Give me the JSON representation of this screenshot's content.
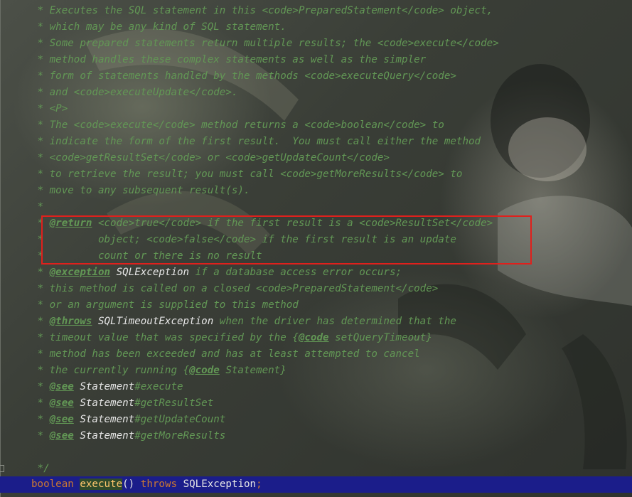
{
  "doc_lines": [
    [
      {
        "t": " * Executes the SQL statement in this <code>PreparedStatement</code> object,"
      }
    ],
    [
      {
        "t": " * which may be any kind of SQL statement."
      }
    ],
    [
      {
        "t": " * Some prepared statements return multiple results; the <code>execute</code>"
      }
    ],
    [
      {
        "t": " * method handles these complex statements as well as the simpler"
      }
    ],
    [
      {
        "t": " * form of statements handled by the methods <code>executeQuery</code>"
      }
    ],
    [
      {
        "t": " * and <code>executeUpdate</code>."
      }
    ],
    [
      {
        "t": " * <P>"
      }
    ],
    [
      {
        "t": " * The <code>execute</code> method returns a <code>boolean</code> to"
      }
    ],
    [
      {
        "t": " * indicate the form of the first result.  You must call either the method"
      }
    ],
    [
      {
        "t": " * <code>getResultSet</code> or <code>getUpdateCount</code>"
      }
    ],
    [
      {
        "t": " * to retrieve the result; you must call <code>getMoreResults</code> to"
      }
    ],
    [
      {
        "t": " * move to any subsequent result(s)."
      }
    ],
    [
      {
        "t": " *"
      }
    ],
    [
      {
        "t": " * "
      },
      {
        "t": "@return",
        "k": "tag"
      },
      {
        "t": " <code>true</code> if the first result is a <code>ResultSet</code>"
      }
    ],
    [
      {
        "t": " *         object; <code>false</code> if the first result is an update"
      }
    ],
    [
      {
        "t": " *         count or there is no result"
      }
    ],
    [
      {
        "t": " * "
      },
      {
        "t": "@exception",
        "k": "tag"
      },
      {
        "t": " "
      },
      {
        "t": "SQLException",
        "k": "ref"
      },
      {
        "t": " if a database access error occurs;"
      }
    ],
    [
      {
        "t": " * this method is called on a closed <code>PreparedStatement</code>"
      }
    ],
    [
      {
        "t": " * or an argument is supplied to this method"
      }
    ],
    [
      {
        "t": " * "
      },
      {
        "t": "@throws",
        "k": "tag"
      },
      {
        "t": " "
      },
      {
        "t": "SQLTimeoutException",
        "k": "ref"
      },
      {
        "t": " when the driver has determined that the"
      }
    ],
    [
      {
        "t": " * timeout value that was specified by the {"
      },
      {
        "t": "@code",
        "k": "tag"
      },
      {
        "t": " setQueryTimeout}"
      }
    ],
    [
      {
        "t": " * method has been exceeded and has at least attempted to cancel"
      }
    ],
    [
      {
        "t": " * the currently running {"
      },
      {
        "t": "@code",
        "k": "tag"
      },
      {
        "t": " Statement}"
      }
    ],
    [
      {
        "t": " * "
      },
      {
        "t": "@see",
        "k": "tag"
      },
      {
        "t": " "
      },
      {
        "t": "Statement",
        "k": "ref"
      },
      {
        "t": "#execute"
      }
    ],
    [
      {
        "t": " * "
      },
      {
        "t": "@see",
        "k": "tag"
      },
      {
        "t": " "
      },
      {
        "t": "Statement",
        "k": "ref"
      },
      {
        "t": "#getResultSet"
      }
    ],
    [
      {
        "t": " * "
      },
      {
        "t": "@see",
        "k": "tag"
      },
      {
        "t": " "
      },
      {
        "t": "Statement",
        "k": "ref"
      },
      {
        "t": "#getUpdateCount"
      }
    ],
    [
      {
        "t": " * "
      },
      {
        "t": "@see",
        "k": "tag"
      },
      {
        "t": " "
      },
      {
        "t": "Statement",
        "k": "ref"
      },
      {
        "t": "#getMoreResults"
      }
    ],
    [
      {
        "t": ""
      }
    ],
    [
      {
        "t": " */"
      }
    ]
  ],
  "declaration": {
    "return_type": "boolean",
    "method_name": "execute",
    "parens": "()",
    "throws_kw": "throws",
    "exception": "SQLException",
    "terminator": ";"
  },
  "colors": {
    "doc_comment": "#629755",
    "keyword": "#cc7832",
    "method": "#ffc66d",
    "current_line": "#1b1d8a",
    "highlight_box": "#e0201c"
  }
}
